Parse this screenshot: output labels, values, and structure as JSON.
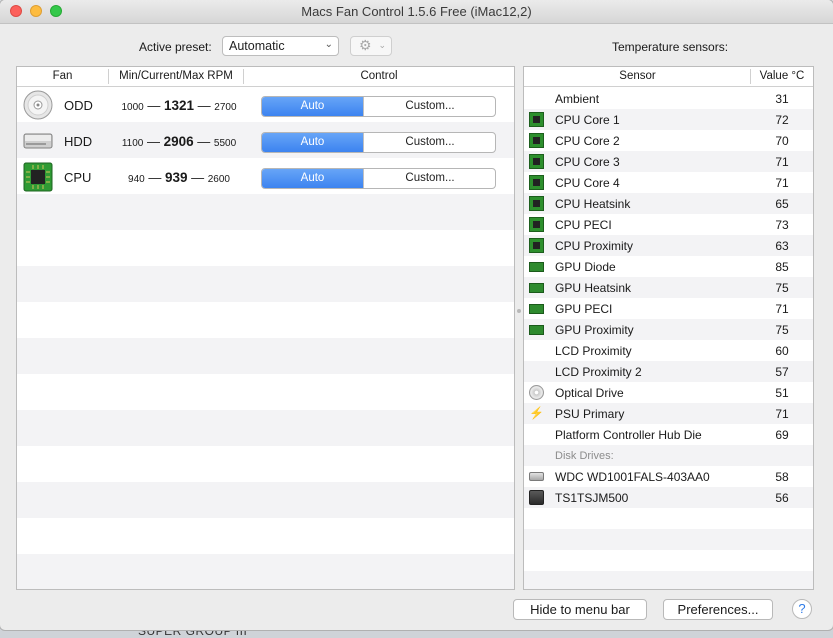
{
  "window": {
    "title": "Macs Fan Control 1.5.6 Free (iMac12,2)"
  },
  "toolbar": {
    "preset_label": "Active preset:",
    "preset_value": "Automatic",
    "gear_icon": "gear-icon",
    "temp_sensors_label": "Temperature sensors:"
  },
  "fans": {
    "headers": {
      "fan": "Fan",
      "rpm": "Min/Current/Max RPM",
      "control": "Control"
    },
    "rows": [
      {
        "name": "ODD",
        "icon": "optical-drive-icon",
        "min": "1000",
        "current": "1321",
        "max": "2700",
        "auto": "Auto",
        "custom": "Custom..."
      },
      {
        "name": "HDD",
        "icon": "hard-drive-icon",
        "min": "1100",
        "current": "2906",
        "max": "5500",
        "auto": "Auto",
        "custom": "Custom..."
      },
      {
        "name": "CPU",
        "icon": "cpu-chip-icon",
        "min": "940",
        "current": "939",
        "max": "2600",
        "auto": "Auto",
        "custom": "Custom..."
      }
    ],
    "dash": "—"
  },
  "sensors": {
    "headers": {
      "sensor": "Sensor",
      "value": "Value °C"
    },
    "rows": [
      {
        "name": "Ambient",
        "value": "31",
        "icon": ""
      },
      {
        "name": "CPU Core 1",
        "value": "72",
        "icon": "chip"
      },
      {
        "name": "CPU Core 2",
        "value": "70",
        "icon": "chip"
      },
      {
        "name": "CPU Core 3",
        "value": "71",
        "icon": "chip"
      },
      {
        "name": "CPU Core 4",
        "value": "71",
        "icon": "chip"
      },
      {
        "name": "CPU Heatsink",
        "value": "65",
        "icon": "chip"
      },
      {
        "name": "CPU PECI",
        "value": "73",
        "icon": "chip"
      },
      {
        "name": "CPU Proximity",
        "value": "63",
        "icon": "chip"
      },
      {
        "name": "GPU Diode",
        "value": "85",
        "icon": "gpu"
      },
      {
        "name": "GPU Heatsink",
        "value": "75",
        "icon": "gpu"
      },
      {
        "name": "GPU PECI",
        "value": "71",
        "icon": "gpu"
      },
      {
        "name": "GPU Proximity",
        "value": "75",
        "icon": "gpu"
      },
      {
        "name": "LCD Proximity",
        "value": "60",
        "icon": ""
      },
      {
        "name": "LCD Proximity 2",
        "value": "57",
        "icon": ""
      },
      {
        "name": "Optical Drive",
        "value": "51",
        "icon": "disc"
      },
      {
        "name": "PSU Primary",
        "value": "71",
        "icon": "bolt"
      },
      {
        "name": "Platform Controller Hub Die",
        "value": "69",
        "icon": ""
      }
    ],
    "disk_section_label": "Disk Drives:",
    "disks": [
      {
        "name": "WDC WD1001FALS-403AA0",
        "value": "58",
        "icon": "hdd"
      },
      {
        "name": "TS1TSJM500",
        "value": "56",
        "icon": "ssd"
      }
    ]
  },
  "footer": {
    "hide_label": "Hide to menu bar",
    "prefs_label": "Preferences...",
    "help_label": "?"
  },
  "desktop": {
    "partial_text": "SUPER GROUP III"
  }
}
